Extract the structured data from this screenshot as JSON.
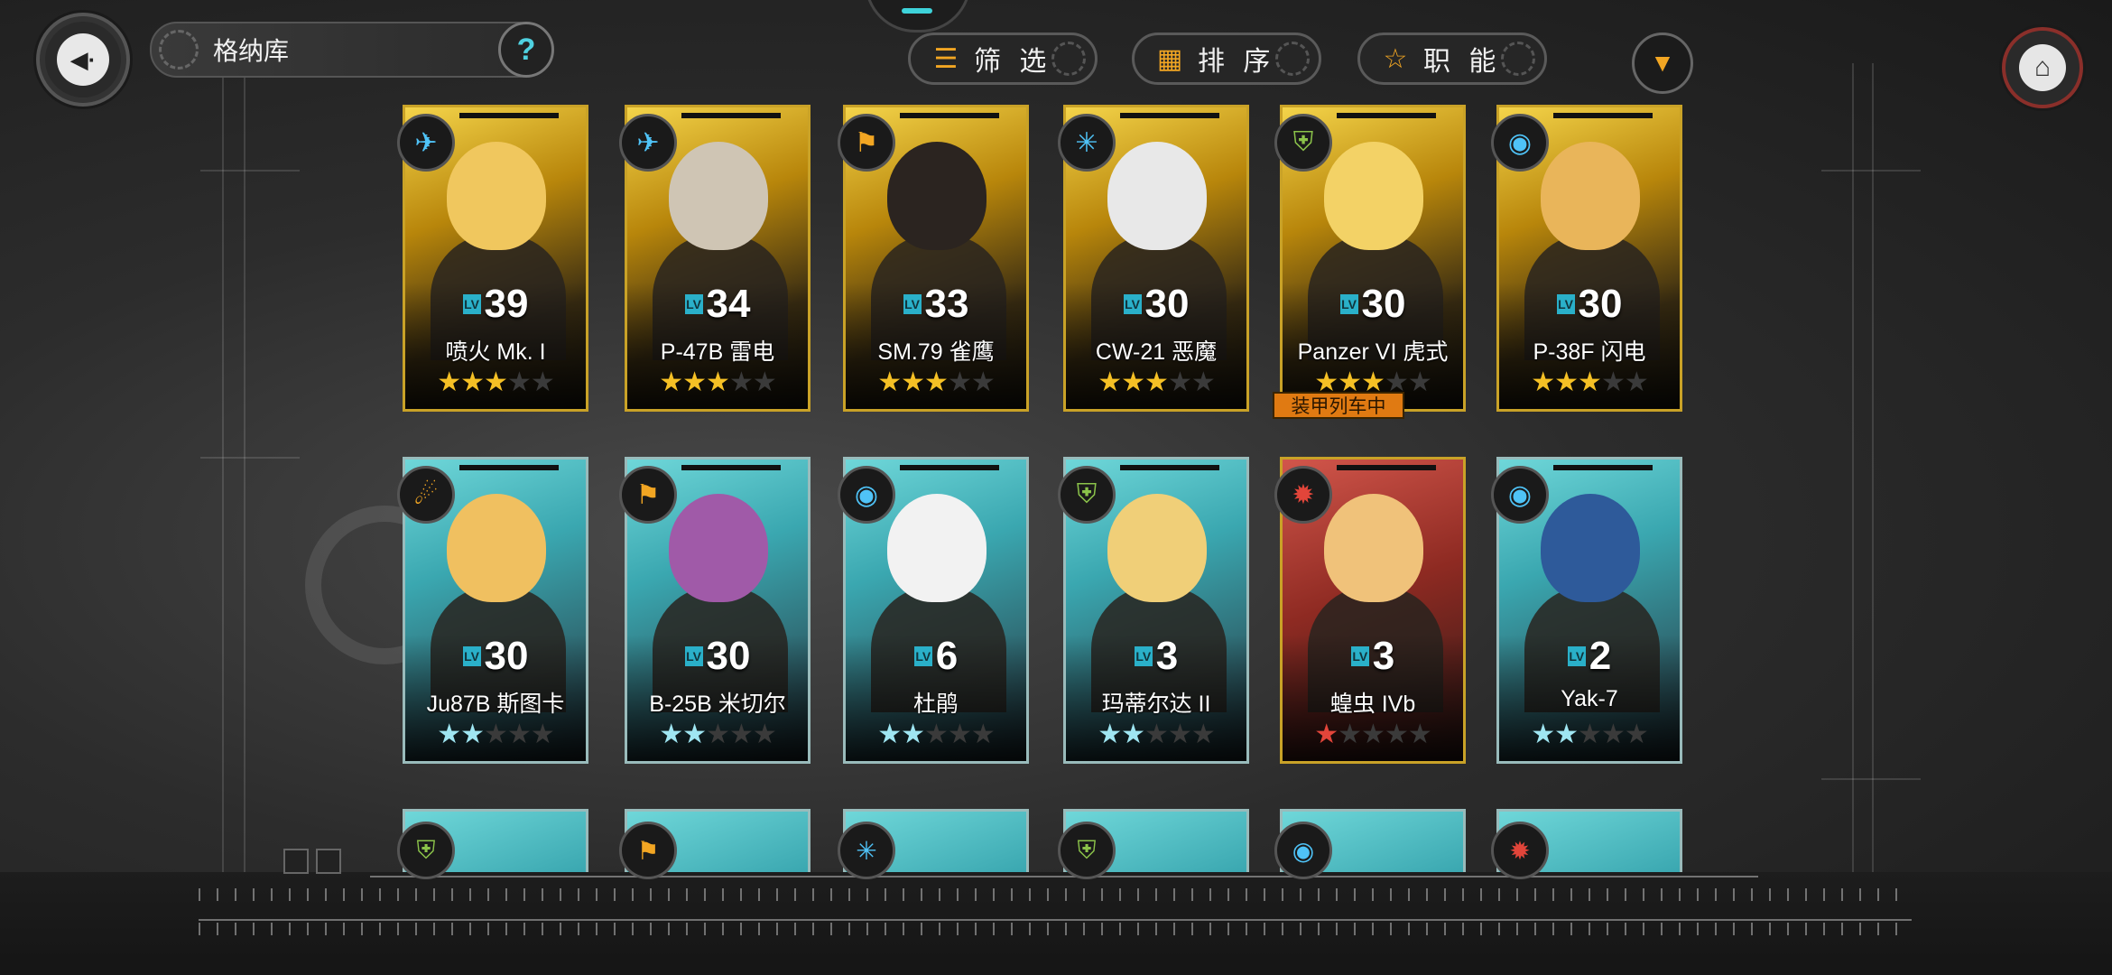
{
  "header": {
    "title": "格纳库",
    "help_glyph": "?",
    "back_icon": "back-arrow-icon",
    "home_icon": "home-icon"
  },
  "toolbar": {
    "filter_label": "筛 选",
    "sort_label": "排 序",
    "role_label": "职 能"
  },
  "accent_colors": {
    "orange": "#f2a623",
    "teal": "#3ed3da",
    "gold_frame": "#c9a227"
  },
  "units": [
    {
      "level": "39",
      "name": "喷火 Mk. I",
      "stars": 3,
      "max_stars": 5,
      "rarity": "gold",
      "class_icon": "fighter-icon"
    },
    {
      "level": "34",
      "name": "P-47B 雷电",
      "stars": 3,
      "max_stars": 5,
      "rarity": "gold",
      "class_icon": "fighter-icon"
    },
    {
      "level": "33",
      "name": "SM.79 雀鹰",
      "stars": 3,
      "max_stars": 5,
      "rarity": "gold",
      "class_icon": "bomber-icon"
    },
    {
      "level": "30",
      "name": "CW-21 恶魔",
      "stars": 3,
      "max_stars": 5,
      "rarity": "gold",
      "class_icon": "interceptor-icon"
    },
    {
      "level": "30",
      "name": "Panzer VI 虎式",
      "stars": 3,
      "max_stars": 5,
      "rarity": "gold",
      "class_icon": "tank-icon",
      "tag": "装甲列车中"
    },
    {
      "level": "30",
      "name": "P-38F 闪电",
      "stars": 3,
      "max_stars": 5,
      "rarity": "gold",
      "class_icon": "heavy-fighter-icon"
    },
    {
      "level": "30",
      "name": "Ju87B 斯图卡",
      "stars": 2,
      "max_stars": 5,
      "rarity": "teal",
      "class_icon": "dive-bomber-icon"
    },
    {
      "level": "30",
      "name": "B-25B 米切尔",
      "stars": 2,
      "max_stars": 5,
      "rarity": "teal",
      "class_icon": "bomber-icon"
    },
    {
      "level": "6",
      "name": "杜鹃",
      "stars": 2,
      "max_stars": 5,
      "rarity": "teal",
      "class_icon": "heavy-fighter-icon"
    },
    {
      "level": "3",
      "name": "玛蒂尔达 II",
      "stars": 2,
      "max_stars": 5,
      "rarity": "teal",
      "class_icon": "tank-icon"
    },
    {
      "level": "3",
      "name": "蝗虫 IVb",
      "stars": 1,
      "max_stars": 5,
      "rarity": "red",
      "class_icon": "artillery-icon"
    },
    {
      "level": "2",
      "name": "Yak-7",
      "stars": 2,
      "max_stars": 5,
      "rarity": "teal",
      "class_icon": "heavy-fighter-icon"
    }
  ],
  "partial_row_icons": [
    "tank-icon",
    "bomber-icon",
    "interceptor-icon",
    "tank-icon",
    "heavy-fighter-icon",
    "artillery-icon"
  ]
}
